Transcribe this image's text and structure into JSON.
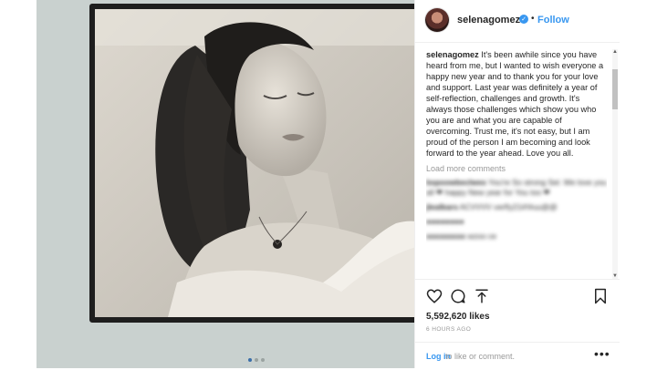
{
  "post": {
    "username": "selenagomez",
    "separator": "•",
    "follow_label": "Follow",
    "verified_glyph": "✓",
    "caption_username": "selenagomez",
    "caption_text": "It's been awhile since you have heard from me, but I wanted to wish everyone a happy new year and to thank you for your love and support. Last year was definitely a year of self-reflection, challenges and growth. It's always those challenges which show you who you are and what you are capable of overcoming. Trust me, it's not easy, but I am proud of the person I am becoming and look forward to the year ahead. Love you all.",
    "load_more_label": "Load more comments",
    "likes": "5,592,620 likes",
    "time_ago": "6 HOURS AGO",
    "login_link": "Log in",
    "login_rest": "to like or comment.",
    "more_glyph": "•••"
  },
  "blurred_comments": [
    {
      "user": "bspoowbeclwes",
      "text": "You're So strong Sel. We love you all ❤ happy New year for You too ❤"
    },
    {
      "user": "jlealbars",
      "text": "ACVVVV verfIy21#!#uu@@"
    },
    {
      "user": "",
      "text": "●●●●●●●●"
    },
    {
      "user": "xxxxxxxxx",
      "text": "wzoo ce"
    }
  ],
  "icons": {
    "next_arrow": "chevron-right-icon",
    "like": "heart-icon",
    "comment": "comment-icon",
    "share": "share-icon",
    "save": "bookmark-icon"
  },
  "colors": {
    "accent": "#3897f0",
    "text": "#262626",
    "muted": "#999999",
    "media_backdrop": "#c9d1cf"
  }
}
